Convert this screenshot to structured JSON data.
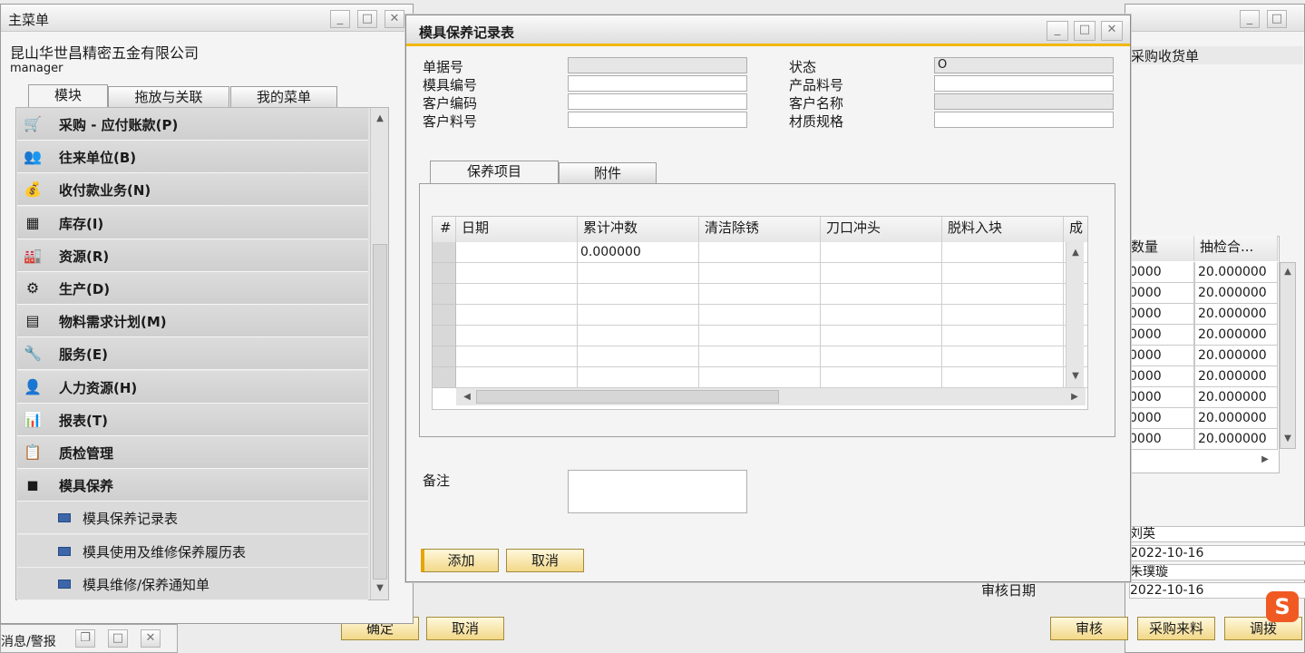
{
  "main_menu": {
    "title": "主菜单",
    "company": "昆山华世昌精密五金有限公司",
    "user": "manager",
    "tabs": [
      "模块",
      "拖放与关联",
      "我的菜单"
    ],
    "items": [
      {
        "label": "采购 - 应付账款(P)",
        "icon": "shopping-cart-icon",
        "glyph": "🛒"
      },
      {
        "label": "往来单位(B)",
        "icon": "business-partners-icon",
        "glyph": "👥"
      },
      {
        "label": "收付款业务(N)",
        "icon": "banking-icon",
        "glyph": "💰"
      },
      {
        "label": "库存(I)",
        "icon": "inventory-icon",
        "glyph": "▦"
      },
      {
        "label": "资源(R)",
        "icon": "resources-icon",
        "glyph": "🏭"
      },
      {
        "label": "生产(D)",
        "icon": "production-icon",
        "glyph": "⚙"
      },
      {
        "label": "物料需求计划(M)",
        "icon": "mrp-icon",
        "glyph": "▤"
      },
      {
        "label": "服务(E)",
        "icon": "service-icon",
        "glyph": "🔧"
      },
      {
        "label": "人力资源(H)",
        "icon": "human-resources-icon",
        "glyph": "👤"
      },
      {
        "label": "报表(T)",
        "icon": "reports-icon",
        "glyph": "📊"
      },
      {
        "label": "质检管理",
        "icon": "quality-inspection-icon",
        "glyph": "📋"
      },
      {
        "label": "模具保养",
        "icon": "mold-maintenance-icon",
        "glyph": "◼"
      }
    ],
    "subitems": [
      "模具保养记录表",
      "模具使用及维修保养履历表",
      "模具维修/保养通知单"
    ]
  },
  "bottom_bar": {
    "label": "消息/警报"
  },
  "dialog": {
    "title": "模具保养记录表",
    "fields": {
      "doc_no": {
        "label": "单据号",
        "value": ""
      },
      "status": {
        "label": "状态",
        "value": "O"
      },
      "mold_no": {
        "label": "模具编号",
        "value": ""
      },
      "product_no": {
        "label": "产品料号",
        "value": ""
      },
      "customer_code": {
        "label": "客户编码",
        "value": ""
      },
      "customer_name": {
        "label": "客户名称",
        "value": ""
      },
      "customer_part": {
        "label": "客户料号",
        "value": ""
      },
      "material_spec": {
        "label": "材质规格",
        "value": ""
      }
    },
    "tabs": [
      "保养项目",
      "附件"
    ],
    "grid": {
      "columns": [
        "#",
        "日期",
        "累计冲数",
        "清洁除锈",
        "刀口冲头",
        "脱料入块",
        "成"
      ],
      "rows": [
        [
          "",
          "",
          "0.000000",
          "",
          "",
          "",
          ""
        ],
        [
          "",
          "",
          "",
          "",
          "",
          "",
          ""
        ],
        [
          "",
          "",
          "",
          "",
          "",
          "",
          ""
        ],
        [
          "",
          "",
          "",
          "",
          "",
          "",
          ""
        ],
        [
          "",
          "",
          "",
          "",
          "",
          "",
          ""
        ],
        [
          "",
          "",
          "",
          "",
          "",
          "",
          ""
        ],
        [
          "",
          "",
          "",
          "",
          "",
          "",
          ""
        ]
      ]
    },
    "remarks_label": "备注",
    "remarks_value": "",
    "add_button": "添加",
    "cancel_button": "取消"
  },
  "background_window": {
    "doc_title": "采购收货单",
    "grid_headers": [
      "数量",
      "抽检合..."
    ],
    "qty_values": [
      "0000",
      "0000",
      "0000",
      "0000",
      "0000",
      "0000",
      "0000",
      "0000",
      "0000"
    ],
    "inspect_values": [
      "20.000000",
      "20.000000",
      "20.000000",
      "20.000000",
      "20.000000",
      "20.000000",
      "20.000000",
      "20.000000",
      "20.000000"
    ],
    "footer": {
      "person1": "刘英",
      "date1": "2022-10-16",
      "person2": "朱璞璇",
      "review_date_label": "审核日期",
      "review_date": "2022-10-16"
    },
    "buttons": {
      "confirm": "确定",
      "cancel": "取消",
      "approve": "审核",
      "purchase_incoming": "采购来料",
      "allocate": "调拨"
    }
  }
}
